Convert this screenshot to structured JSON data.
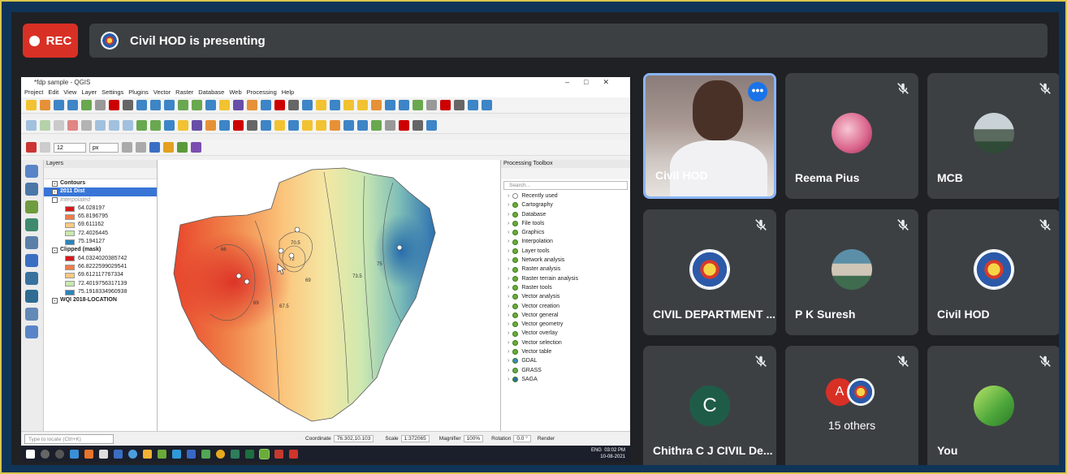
{
  "meeting": {
    "rec_label": "REC",
    "presenting_text": "Civil HOD is presenting"
  },
  "qgis": {
    "window_title": "*fdp sample - QGIS",
    "menu": [
      "Project",
      "Edit",
      "View",
      "Layer",
      "Settings",
      "Plugins",
      "Vector",
      "Raster",
      "Database",
      "Web",
      "Processing",
      "Help"
    ],
    "size_value": "12",
    "size_unit": "px",
    "layers_title": "Layers",
    "layers": [
      {
        "label": "Contours",
        "bold": true,
        "checked": true,
        "swatch": ""
      },
      {
        "label": "2011 Dist",
        "bold": true,
        "checked": true,
        "swatch": "",
        "selected": true
      },
      {
        "label": "Interpolated",
        "bold": false,
        "checked": false,
        "swatch": "",
        "italic": true
      },
      {
        "label": "64.028197",
        "swatch": "#d7191c"
      },
      {
        "label": "65.8196795",
        "swatch": "#f07c4a"
      },
      {
        "label": "69.611162",
        "swatch": "#fec980"
      },
      {
        "label": "72.4026445",
        "swatch": "#c7e8ad"
      },
      {
        "label": "75.194127",
        "swatch": "#2b83ba"
      },
      {
        "label": "Clipped (mask)",
        "bold": true,
        "checked": true,
        "swatch": ""
      },
      {
        "label": "64.0324020385742",
        "swatch": "#d7191c"
      },
      {
        "label": "66.8222599029541",
        "swatch": "#f07c4a"
      },
      {
        "label": "69.612117767334",
        "swatch": "#fec980"
      },
      {
        "label": "72.4019756317139",
        "swatch": "#c7e8ad"
      },
      {
        "label": "75.1918334960938",
        "swatch": "#2b83ba"
      },
      {
        "label": "WQI 2018-LOCATION",
        "bold": true,
        "checked": true,
        "swatch": ""
      }
    ],
    "toolbox_title": "Processing Toolbox",
    "toolbox_search_placeholder": "Search...",
    "toolbox_items": [
      "Recently used",
      "Cartography",
      "Database",
      "File tools",
      "Graphics",
      "Interpolation",
      "Layer tools",
      "Network analysis",
      "Raster analysis",
      "Raster terrain analysis",
      "Raster tools",
      "Vector analysis",
      "Vector creation",
      "Vector general",
      "Vector geometry",
      "Vector overlay",
      "Vector selection",
      "Vector table",
      "GDAL",
      "GRASS",
      "SAGA"
    ],
    "contour_labels": [
      "66",
      "69",
      "69",
      "70.5",
      "72",
      "73.5",
      "75",
      "67.5"
    ],
    "status": {
      "locate_placeholder": "Type to locate (Ctrl+K)",
      "coordinate_label": "Coordinate",
      "coordinate_value": "76.302,10.103",
      "scale_label": "Scale",
      "scale_value": "1:372065",
      "magnifier_label": "Magnifier",
      "magnifier_value": "100%",
      "rotation_label": "Rotation",
      "rotation_value": "0.0 °",
      "render_label": "Render"
    },
    "taskbar": {
      "lang": "ENG",
      "time": "03:02 PM",
      "date": "10-08-2021"
    }
  },
  "participants": [
    {
      "name": "Civil HOD",
      "kind": "video"
    },
    {
      "name": "Reema Pius",
      "kind": "photo-pink"
    },
    {
      "name": "MCB",
      "kind": "photo-mountain"
    },
    {
      "name": "CIVIL DEPARTMENT ...",
      "kind": "seal"
    },
    {
      "name": "P K Suresh",
      "kind": "photo-room"
    },
    {
      "name": "Civil HOD",
      "kind": "seal"
    },
    {
      "name": "Chithra C J CIVIL De...",
      "kind": "letter",
      "letter": "C"
    },
    {
      "name": "15 others",
      "kind": "others",
      "letter": "A"
    },
    {
      "name": "You",
      "kind": "photo-green"
    }
  ]
}
